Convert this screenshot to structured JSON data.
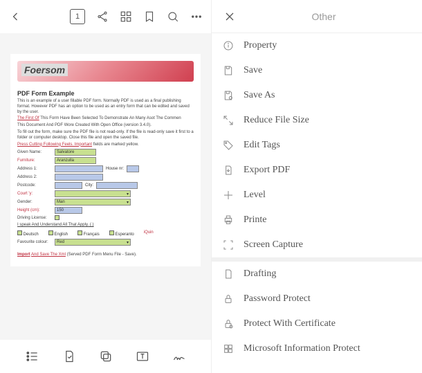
{
  "topbar": {
    "page_number": "1"
  },
  "doc": {
    "banner_title": "Foersom",
    "heading": "PDF Form Example",
    "p1": "This is an example of a user fillable PDF form. Normally PDF is used as a final publishing format. However PDF has an option to be used as an entry form that can be edited and saved by the user.",
    "p2a": "The First Of",
    "p2b": " This Form Have Been Selected To Demonstrate An Many Asot The Commen",
    "p3": "This Document And PDF Wore Created With Open Office (version 3.4.0).",
    "p4": "To fill out the form, make sure the PDF file is not read-only. If the file is read-only save it first to a folder or computer desktop. Close this file and open the saved file.",
    "p5a": "Press Cutting Following Feels. Important",
    "p5b": " fields are marked yellow.",
    "given_name_label": "Given Name:",
    "given_name_value": "Salvatore",
    "family_name_label": "Furniture:",
    "family_name_value": "Aranzulla",
    "address1_label": "Address 1:",
    "house_nr_label": "House nr:",
    "address2_label": "Address 2:",
    "postcode_label": "Postcode:",
    "city_label": "City:",
    "country_label": "Court 'y:",
    "gender_label": "Gender:",
    "gender_value": "Man",
    "height_label": "Height (cm):",
    "height_value": "150",
    "driving_label": "Driving License:",
    "speak_label": "I speak And Understand All That Apply. ( )",
    "chk_deutsch": "Deutsch",
    "chk_english": "English",
    "chk_francais": "Français",
    "chk_esperanto": "Esperanto",
    "chk_latin": "iQuin",
    "fav_colour_label": "Favourite colour:",
    "fav_colour_value": "Red",
    "footer_a": "Import",
    "footer_b": "And Save The Xml",
    "footer_c": "(Served PDF Form Menu File - Save).",
    "colors": {
      "green": "#c8e090",
      "blue": "#b8c8e8"
    }
  },
  "right": {
    "title": "Other",
    "items": [
      "Property",
      "Save",
      "Save As",
      "Reduce File Size",
      "Edit Tags",
      "Export PDF",
      "Level",
      "Printe",
      "Screen Capture",
      "Drafting",
      "Password Protect",
      "Protect With Certificate",
      "Microsoft Information Protect"
    ]
  }
}
